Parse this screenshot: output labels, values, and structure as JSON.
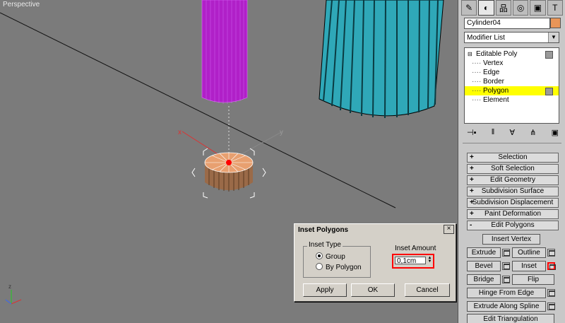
{
  "viewport": {
    "label": "Perspective"
  },
  "command_panel": {
    "tabs": [
      {
        "icon": "create-icon",
        "glyph": "✎"
      },
      {
        "icon": "modify-icon",
        "glyph": "◐"
      },
      {
        "icon": "hierarchy-icon",
        "glyph": "品"
      },
      {
        "icon": "motion-icon",
        "glyph": "◎"
      },
      {
        "icon": "display-icon",
        "glyph": "▣"
      },
      {
        "icon": "utilities-icon",
        "glyph": "T"
      }
    ],
    "object_name": "Cylinder04",
    "object_color": "#e89558",
    "modifier_list": "Modifier List",
    "stack": [
      "Editable Poly",
      "Vertex",
      "Edge",
      "Border",
      "Polygon",
      "Element"
    ],
    "selected_stack_item": "Polygon",
    "rollouts": [
      {
        "sign": "+",
        "label": "Selection"
      },
      {
        "sign": "+",
        "label": "Soft Selection"
      },
      {
        "sign": "+",
        "label": "Edit Geometry"
      },
      {
        "sign": "+",
        "label": "Subdivision Surface"
      },
      {
        "sign": "+",
        "label": "Subdivision Displacement"
      },
      {
        "sign": "+",
        "label": "Paint Deformation"
      },
      {
        "sign": "-",
        "label": "Edit Polygons"
      }
    ],
    "edit_polygons": {
      "insert_vertex": "Insert Vertex",
      "extrude": "Extrude",
      "outline": "Outline",
      "bevel": "Bevel",
      "inset": "Inset",
      "bridge": "Bridge",
      "flip": "Flip",
      "hinge": "Hinge From Edge",
      "extrude_spline": "Extrude Along Spline",
      "edit_triangulation": "Edit Triangulation"
    }
  },
  "dialog": {
    "title": "Inset Polygons",
    "close": "×",
    "inset_type_label": "Inset Type",
    "option_group": "Group",
    "option_by_polygon": "By Polygon",
    "selected_option": "Group",
    "amount_label": "Inset Amount",
    "amount_value": "0,1cm",
    "apply": "Apply",
    "ok": "OK",
    "cancel": "Cancel"
  },
  "colors": {
    "accent_highlight": "#ffff00",
    "alert_outline": "#ff0000",
    "purple_cylinder": "#b020c8",
    "teal_cylinder": "#2fa8b8",
    "orange_cylinder": "#d0905a"
  }
}
